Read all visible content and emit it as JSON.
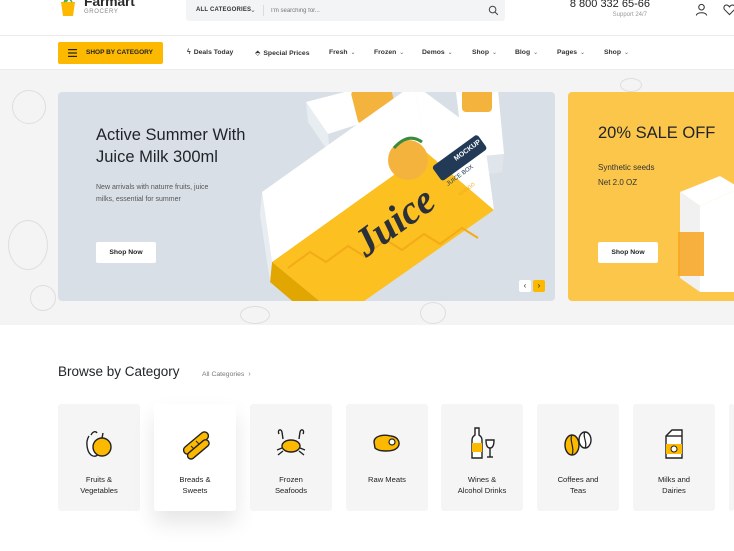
{
  "header": {
    "brand_name": "Farmart",
    "brand_sub": "GROCERY",
    "search": {
      "category_label": "ALL CATEGORIES",
      "placeholder": "I'm searching for..."
    },
    "phone": "8 800 332 65-66",
    "support": "Support 24/7"
  },
  "nav": {
    "category_button": "SHOP BY CATEGORY",
    "items": [
      {
        "label": "Deals Today",
        "icon": "bolt-icon"
      },
      {
        "label": "Special Prices",
        "icon": "tag-icon"
      },
      {
        "label": "Fresh"
      },
      {
        "label": "Frozen"
      },
      {
        "label": "Demos"
      },
      {
        "label": "Shop"
      },
      {
        "label": "Blog"
      },
      {
        "label": "Pages"
      },
      {
        "label": "Shop"
      }
    ]
  },
  "hero": {
    "main": {
      "title_line1": "Active Summer With",
      "title_line2": "Juice Milk 300ml",
      "desc_line1": "New arrivals with naturre  fruits, juice",
      "desc_line2": "milks, essential for summer",
      "button": "Shop Now",
      "pack_text_1": "MOCKUP",
      "pack_text_2": "Juice",
      "pack_text_3": "JUICE BOX",
      "pack_text_4": "MANGO"
    },
    "side": {
      "title": "20% SALE OFF",
      "desc_line1": "Synthetic seeds",
      "desc_line2": "Net 2.0 OZ",
      "button": "Shop Now"
    },
    "arrows": {
      "prev": "‹",
      "next": "›"
    }
  },
  "categories": {
    "title": "Browse by Category",
    "all_link": "All Categories",
    "items": [
      {
        "line1": "Fruits &",
        "line2": "Vegetables",
        "icon": "fruits-icon"
      },
      {
        "line1": "Breads &",
        "line2": "Sweets",
        "icon": "bread-icon"
      },
      {
        "line1": "Frozen",
        "line2": "Seafoods",
        "icon": "crab-icon"
      },
      {
        "line1": "Raw Meats",
        "line2": "",
        "icon": "meat-icon"
      },
      {
        "line1": "Wines &",
        "line2": "Alcohol Drinks",
        "icon": "wine-icon"
      },
      {
        "line1": "Coffees and",
        "line2": "Teas",
        "icon": "coffee-beans-icon"
      },
      {
        "line1": "Milks and",
        "line2": "Dairies",
        "icon": "milk-carton-icon"
      }
    ]
  },
  "colors": {
    "accent": "#fcb900",
    "slide_main_bg": "#d9dfe6",
    "slide_side_bg": "#fbc64a"
  }
}
